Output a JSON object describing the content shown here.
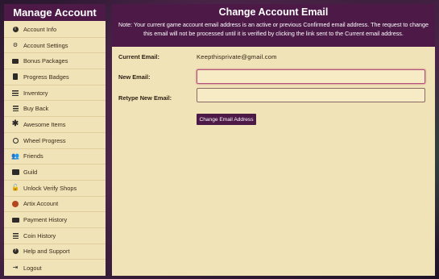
{
  "sidebar": {
    "title": "Manage Account",
    "items": [
      {
        "label": "Account Info",
        "icon": "info-icon"
      },
      {
        "label": "Account Settings",
        "icon": "gear-icon"
      },
      {
        "label": "Bonus Packages",
        "icon": "package-icon"
      },
      {
        "label": "Progress Badges",
        "icon": "badge-icon"
      },
      {
        "label": "Inventory",
        "icon": "list-icon"
      },
      {
        "label": "Buy Back",
        "icon": "coins-icon"
      },
      {
        "label": "Awesome Items",
        "icon": "asterisk-icon"
      },
      {
        "label": "Wheel Progress",
        "icon": "wheel-icon"
      },
      {
        "label": "Friends",
        "icon": "users-icon"
      },
      {
        "label": "Guild",
        "icon": "guild-icon"
      },
      {
        "label": "Unlock Verify Shops",
        "icon": "unlock-icon"
      },
      {
        "label": "Artix Account",
        "icon": "artix-icon"
      },
      {
        "label": "Payment History",
        "icon": "card-icon"
      },
      {
        "label": "Coin History",
        "icon": "coins-icon"
      },
      {
        "label": "Help and Support",
        "icon": "help-icon"
      },
      {
        "label": "Logout",
        "icon": "logout-icon"
      }
    ]
  },
  "main": {
    "title": "Change Account Email",
    "note": "Note: Your current game account email address is an active or previous Confirmed email address. The request to change this email will not be processed until it is verified by clicking the link sent to the Current email address.",
    "current_email_label": "Current Email:",
    "current_email_value": "Keepthisprivate@gmail.com",
    "new_email_label": "New Email:",
    "new_email_value": "",
    "retype_label": "Retype New Email:",
    "retype_value": "",
    "submit_label": "Change Email Address"
  },
  "colors": {
    "header": "#4d1a48",
    "panel": "#f1e3b8",
    "focus": "#b5507a"
  }
}
